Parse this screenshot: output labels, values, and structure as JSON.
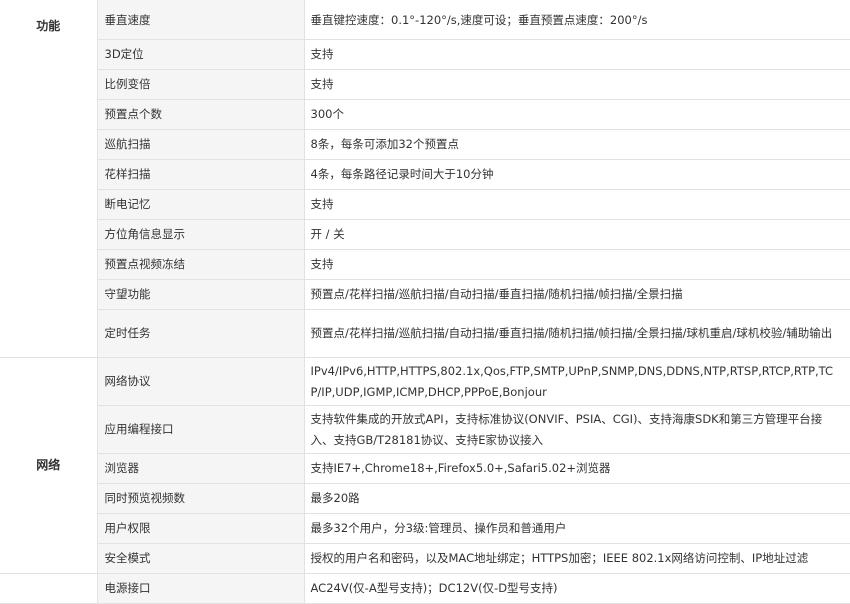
{
  "sections": [
    {
      "category": "功能",
      "rows": [
        {
          "name": "垂直速度",
          "value": "垂直键控速度：0.1°-120°/s,速度可设；垂直预置点速度：200°/s"
        },
        {
          "name": "3D定位",
          "value": "支持"
        },
        {
          "name": "比例变倍",
          "value": "支持"
        },
        {
          "name": "预置点个数",
          "value": "300个"
        },
        {
          "name": "巡航扫描",
          "value": "8条，每条可添加32个预置点"
        },
        {
          "name": "花样扫描",
          "value": "4条，每条路径记录时间大于10分钟"
        },
        {
          "name": "断电记忆",
          "value": "支持"
        },
        {
          "name": "方位角信息显示",
          "value": "开 / 关"
        },
        {
          "name": "预置点视频冻结",
          "value": "支持"
        },
        {
          "name": "守望功能",
          "value": "预置点/花样扫描/巡航扫描/自动扫描/垂直扫描/随机扫描/帧扫描/全景扫描"
        },
        {
          "name": "定时任务",
          "value": "预置点/花样扫描/巡航扫描/自动扫描/垂直扫描/随机扫描/帧扫描/全景扫描/球机重启/球机校验/辅助输出"
        }
      ]
    },
    {
      "category": "网络",
      "rows": [
        {
          "name": "网络协议",
          "value": "IPv4/IPv6,HTTP,HTTPS,802.1x,Qos,FTP,SMTP,UPnP,SNMP,DNS,DDNS,NTP,RTSP,RTCP,RTP,TCP/IP,UDP,IGMP,ICMP,DHCP,PPPoE,Bonjour"
        },
        {
          "name": "应用编程接口",
          "value": "支持软件集成的开放式API，支持标准协议(ONVIF、PSIA、CGI)、支持海康SDK和第三方管理平台接入、支持GB/T28181协议、支持E家协议接入"
        },
        {
          "name": "浏览器",
          "value": "支持IE7+,Chrome18+,Firefox5.0+,Safari5.02+浏览器"
        },
        {
          "name": "同时预览视频数",
          "value": "最多20路"
        },
        {
          "name": "用户权限",
          "value": "最多32个用户，分3级:管理员、操作员和普通用户"
        },
        {
          "name": "安全模式",
          "value": "授权的用户名和密码，以及MAC地址绑定；HTTPS加密；IEEE 802.1x网络访问控制、IP地址过滤"
        }
      ]
    },
    {
      "category": "",
      "rows": [
        {
          "name": "电源接口",
          "value": "AC24V(仅-A型号支持)；DC12V(仅-D型号支持)"
        }
      ]
    }
  ]
}
